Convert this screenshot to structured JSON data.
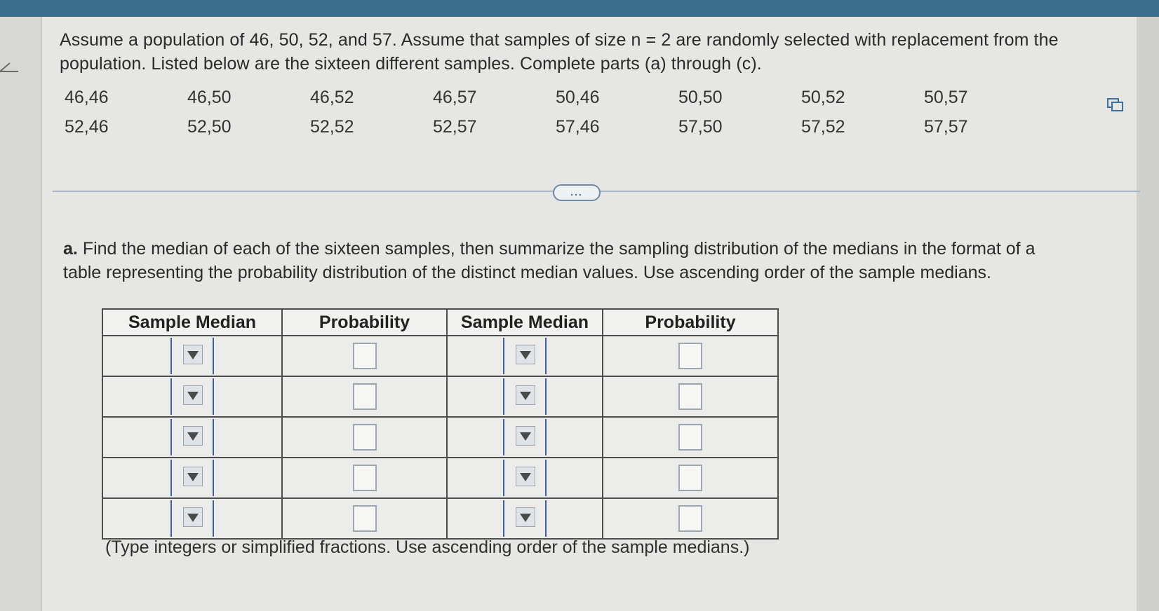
{
  "question": {
    "text": "Assume a population of 46, 50, 52, and 57. Assume that samples of size n = 2 are randomly selected with replacement from the population. Listed below are the sixteen different samples. Complete parts (a) through (c)."
  },
  "samples": {
    "row1": [
      "46,46",
      "46,50",
      "46,52",
      "46,57",
      "50,46",
      "50,50",
      "50,52",
      "50,57"
    ],
    "row2": [
      "52,46",
      "52,50",
      "52,52",
      "52,57",
      "57,46",
      "57,50",
      "57,52",
      "57,57"
    ]
  },
  "more_label": "...",
  "part_a": {
    "label": "a.",
    "text": "Find the median of each of the sixteen samples, then summarize the sampling distribution of the medians in the format of a table representing the probability distribution of the distinct median values. Use ascending order of the sample medians."
  },
  "table": {
    "headers": [
      "Sample Median",
      "Probability",
      "Sample Median",
      "Probability"
    ],
    "rows": 5
  },
  "hint": "(Type integers or simplified fractions. Use ascending order of the sample medians.)",
  "icons": {
    "back": "back-arrow-icon",
    "copy": "copy-icon",
    "dropdown": "dropdown-arrow-icon"
  },
  "colors": {
    "topbar": "#3c6e8f",
    "dropdown_border": "#3e5f9a",
    "table_border": "#4d4d4d"
  }
}
